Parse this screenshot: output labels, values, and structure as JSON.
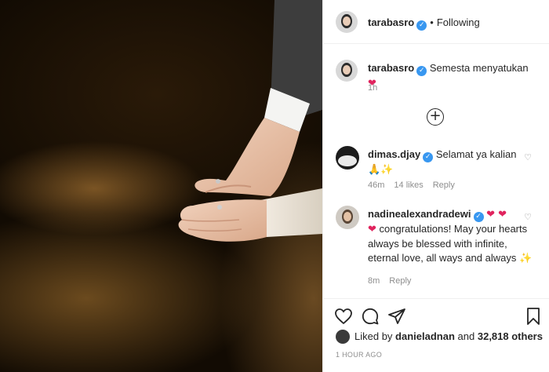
{
  "post": {
    "author": "tarabasro",
    "follow_status": "Following",
    "dot": "•",
    "caption": "Semesta menyatukan",
    "caption_emoji": "❤",
    "caption_time": "1h"
  },
  "add_button": "+",
  "comments": [
    {
      "user": "dimas.djay",
      "text": "Selamat ya kalian",
      "emoji_line": "🙏✨",
      "time": "46m",
      "likes": "14 likes",
      "reply": "Reply"
    },
    {
      "user": "nadinealexandradewi",
      "emoji_prefix": "❤ ❤",
      "text_first": "congratulations! May your hearts always be blessed with infinite, eternal love, all ways and always",
      "heart_lead": "❤",
      "trail_emoji": "✨",
      "time": "8m",
      "reply": "Reply"
    }
  ],
  "likes_line": {
    "prefix": "Liked by",
    "user": "danieladnan",
    "mid": "and",
    "count": "32,818 others"
  },
  "timestamp": "1 HOUR AGO",
  "icons": {
    "verified": "verified-badge-icon",
    "like": "heart-icon",
    "comment": "comment-bubble-icon",
    "share": "paper-plane-icon",
    "save": "bookmark-icon",
    "comment_like": "heart-outline-icon"
  },
  "colors": {
    "verified": "#3897f0",
    "muted": "#8e8e8e",
    "heart": "#e0245e"
  }
}
